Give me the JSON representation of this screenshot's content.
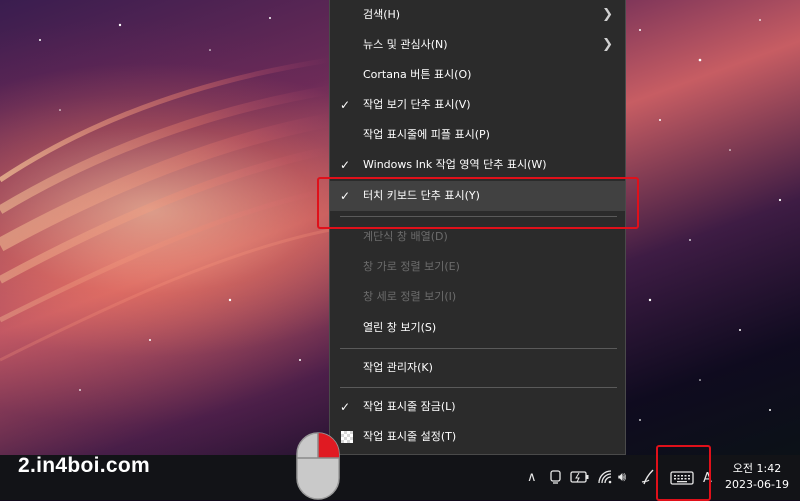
{
  "context_menu": {
    "items": [
      {
        "label": "검색(H)",
        "checked": false,
        "submenu": true,
        "disabled": false
      },
      {
        "label": "뉴스 및 관심사(N)",
        "checked": false,
        "submenu": true,
        "disabled": false
      },
      {
        "label": "Cortana 버튼 표시(O)",
        "checked": false,
        "submenu": false,
        "disabled": false
      },
      {
        "label": "작업 보기 단추 표시(V)",
        "checked": true,
        "submenu": false,
        "disabled": false
      },
      {
        "label": "작업 표시줄에 피플 표시(P)",
        "checked": false,
        "submenu": false,
        "disabled": false
      },
      {
        "label": "Windows Ink 작업 영역 단추 표시(W)",
        "checked": true,
        "submenu": false,
        "disabled": false
      },
      {
        "label": "터치 키보드 단추 표시(Y)",
        "checked": true,
        "submenu": false,
        "disabled": false,
        "highlighted": true
      },
      {
        "label": "계단식 창 배열(D)",
        "checked": false,
        "submenu": false,
        "disabled": true
      },
      {
        "label": "창 가로 정렬 보기(E)",
        "checked": false,
        "submenu": false,
        "disabled": true
      },
      {
        "label": "창 세로 정렬 보기(I)",
        "checked": false,
        "submenu": false,
        "disabled": true
      },
      {
        "label": "열린 창 보기(S)",
        "checked": false,
        "submenu": false,
        "disabled": false
      },
      {
        "label": "작업 관리자(K)",
        "checked": false,
        "submenu": false,
        "disabled": false
      },
      {
        "label": "작업 표시줄 잠금(L)",
        "checked": true,
        "submenu": false,
        "disabled": false
      },
      {
        "label": "작업 표시줄 설정(T)",
        "checked": false,
        "submenu": false,
        "disabled": false,
        "icon": "settings-icon"
      }
    ]
  },
  "watermark": "2.in4boi.com",
  "tray": {
    "icons": [
      "chevron-up-icon",
      "meet-now-icon",
      "battery-icon",
      "wifi-icon",
      "volume-icon",
      "pen-ink-icon",
      "touch-keyboard-icon"
    ],
    "ime_label": "A",
    "time": "오전 1:42",
    "date": "2023-06-19"
  },
  "colors": {
    "menu_bg": "#2b2b2b",
    "highlight": "#414141",
    "annotation_red": "#e0101a",
    "taskbar_bg": "#121317"
  }
}
